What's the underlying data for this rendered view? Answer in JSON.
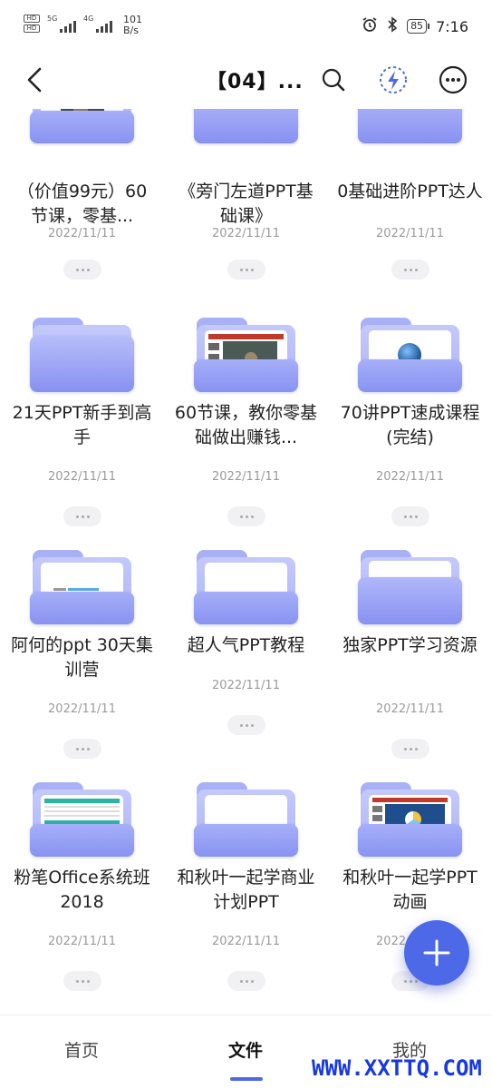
{
  "status_bar": {
    "sim1": "HD",
    "sim2": "HD",
    "net1": "5G",
    "net2": "4G",
    "speed_value": "101",
    "speed_unit": "B/s",
    "battery": "85",
    "time": "7:16"
  },
  "header": {
    "title": "【04】...",
    "icons": [
      "back-arrow-icon",
      "search-icon",
      "lightning-icon",
      "more-options-icon"
    ],
    "accent_color": "#4e69e8"
  },
  "files": [
    {
      "title": "（价值99元）60节课，零基...",
      "date": "2022/11/11"
    },
    {
      "title": "《旁门左道PPT基础课》",
      "date": "2022/11/11"
    },
    {
      "title": "0基础进阶PPT达人",
      "date": "2022/11/11"
    },
    {
      "title": "21天PPT新手到高手",
      "date": "2022/11/11"
    },
    {
      "title": "60节课，教你零基础做出赚钱...",
      "date": "2022/11/11"
    },
    {
      "title": "70讲PPT速成课程(完结)",
      "date": "2022/11/11"
    },
    {
      "title": "阿何的ppt 30天集训营",
      "date": "2022/11/11"
    },
    {
      "title": "超人气PPT教程",
      "date": "2022/11/11"
    },
    {
      "title": "独家PPT学习资源",
      "date": "2022/11/11"
    },
    {
      "title": "粉笔Office系统班2018",
      "date": "2022/11/11"
    },
    {
      "title": "和秋叶一起学商业计划PPT",
      "date": "2022/11/11"
    },
    {
      "title": "和秋叶一起学PPT动画",
      "date": "2022/11/11"
    }
  ],
  "fab": {
    "label": "+"
  },
  "bottom_nav": {
    "items": [
      {
        "label": "首页"
      },
      {
        "label": "文件"
      },
      {
        "label": "我的"
      }
    ],
    "active": "文件"
  },
  "watermark": "WWW.XXTTQ.COM"
}
